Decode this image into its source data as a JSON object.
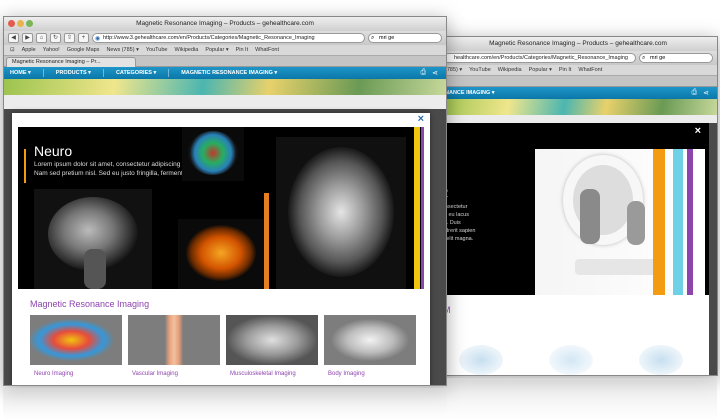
{
  "front": {
    "window_title": "Magnetic Resonance Imaging – Products – gehealthcare.com",
    "url": "http://www.3.gehealthcare.com/en/Products/Categories/Magnetic_Resonance_Imaging",
    "search_value": "mri ge",
    "bookmarks": [
      "Apple",
      "Yahoo!",
      "Google Maps",
      "News (785) ▾",
      "YouTube",
      "Wikipedia",
      "Popular ▾",
      "Pin It",
      "WhatFont"
    ],
    "tab_label": "Magnetic Resonance Imaging – Pr...",
    "nav": [
      "HOME ▾",
      "PRODUCTS ▾",
      "CATEGORIES ▾",
      "MAGNETIC RESONANCE IMAGING ▾"
    ],
    "hero": {
      "title": "Neuro",
      "body": "Lorem ipsum dolor sit amet, consectetur adipiscing elit. Nam sed pretium nisl. Sed eu justo fringilla, fermentu."
    },
    "close_glyph": "×",
    "section_title": "Magnetic Resonance Imaging",
    "thumbs": [
      "Neuro Imaging",
      "Vascular Imaging",
      "Musculoskeletal Imaging",
      "Body Imaging"
    ]
  },
  "back": {
    "window_title": "Magnetic Resonance Imaging – Products – gehealthcare.com",
    "url": "healthcare.com/en/Products/Categories/Magnetic_Resonance_Imaging",
    "search_value": "mri ge",
    "bookmarks": [
      "(785) ▾",
      "YouTube",
      "Wikipedia",
      "Popular ▾",
      "Pin It",
      "WhatFont"
    ],
    "nav_label": "NANCE IMAGING ▾",
    "hero_letter": "R",
    "hero_lines": [
      "consectetur",
      "ero eu lacus",
      "um. Duis",
      "endrerit sapien",
      "us elit magna."
    ],
    "close_glyph": "×"
  },
  "colors": {
    "nav_blue": "#0b77a9",
    "accent_purple": "#8e44ad",
    "accent_orange": "#f39c12"
  }
}
